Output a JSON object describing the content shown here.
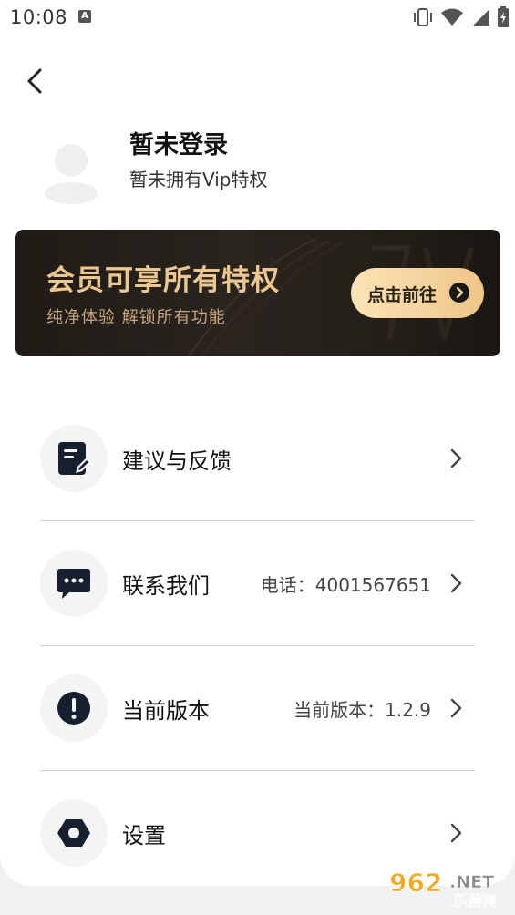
{
  "status_bar": {
    "time": "10:08",
    "notification_letter": "A",
    "icons": [
      "vibrate-icon",
      "wifi-icon",
      "signal-icon",
      "battery-icon"
    ]
  },
  "profile": {
    "name": "暂未登录",
    "vip_status": "暂未拥有Vip特权"
  },
  "banner": {
    "title": "会员可享所有特权",
    "subtitle": "纯净体验 解锁所有功能",
    "button_label": "点击前往"
  },
  "menu": [
    {
      "label": "建议与反馈",
      "value": "",
      "icon": "feedback-icon"
    },
    {
      "label": "联系我们",
      "value": "电话：4001567651",
      "icon": "message-icon"
    },
    {
      "label": "当前版本",
      "value": "当前版本：1.2.9",
      "icon": "info-icon"
    },
    {
      "label": "设置",
      "value": "",
      "icon": "settings-icon"
    }
  ],
  "watermark": {
    "brand": "962",
    "suffix": ".NET",
    "caption": "乐游网"
  },
  "colors": {
    "banner_gold": "#ecc791",
    "banner_dark": "#211b16",
    "icon_dark": "#16202e"
  }
}
